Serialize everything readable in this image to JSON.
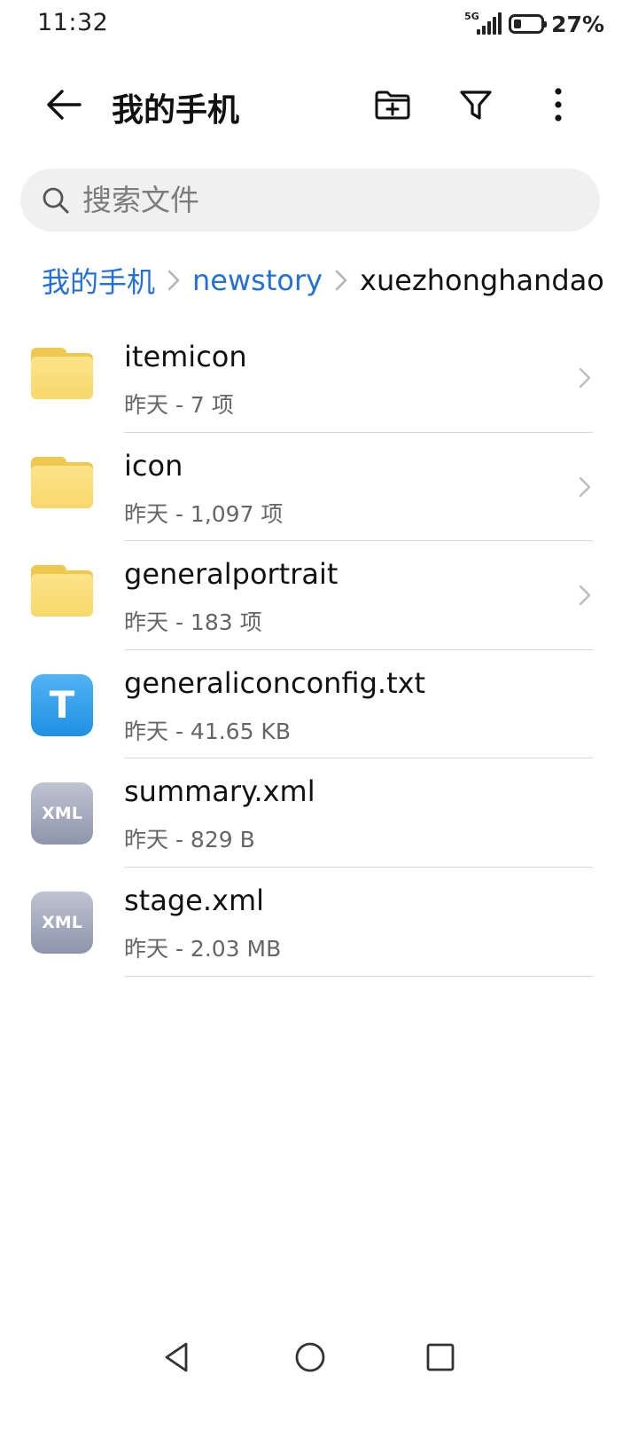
{
  "status_bar": {
    "time": "11:32",
    "network": "5G",
    "battery_percent_text": "27%",
    "battery_level": 0.27
  },
  "app_bar": {
    "title": "我的手机",
    "icons": {
      "back": "back-arrow-icon",
      "new_folder": "new-folder-icon",
      "filter": "filter-icon",
      "more": "more-vertical-icon"
    }
  },
  "search": {
    "placeholder": "搜索文件",
    "value": "",
    "icon": "search-icon"
  },
  "breadcrumb": {
    "items": [
      "我的手机",
      "newstory",
      "xuezhonghandao"
    ]
  },
  "files": [
    {
      "name": "itemicon",
      "meta": "昨天 - 7 项",
      "type": "folder"
    },
    {
      "name": "icon",
      "meta": "昨天 - 1,097 项",
      "type": "folder"
    },
    {
      "name": "generalportrait",
      "meta": "昨天 - 183 项",
      "type": "folder"
    },
    {
      "name": "generaliconconfig.txt",
      "meta": "昨天 - 41.65 KB",
      "type": "txt",
      "icon_glyph": "T"
    },
    {
      "name": "summary.xml",
      "meta": "昨天 - 829 B",
      "type": "xml",
      "icon_glyph": "XML"
    },
    {
      "name": "stage.xml",
      "meta": "昨天 - 2.03 MB",
      "type": "xml",
      "icon_glyph": "XML"
    }
  ],
  "nav_bar": {
    "icons": [
      "back-triangle-icon",
      "home-circle-icon",
      "recents-square-icon"
    ]
  },
  "colors": {
    "accent": "#256fd9",
    "folder": "#f7d86b",
    "txt_icon": "#2a9aea",
    "xml_icon": "#9aa1b4",
    "search_bg": "#f0f0f0",
    "divider": "#d7d7d7"
  }
}
